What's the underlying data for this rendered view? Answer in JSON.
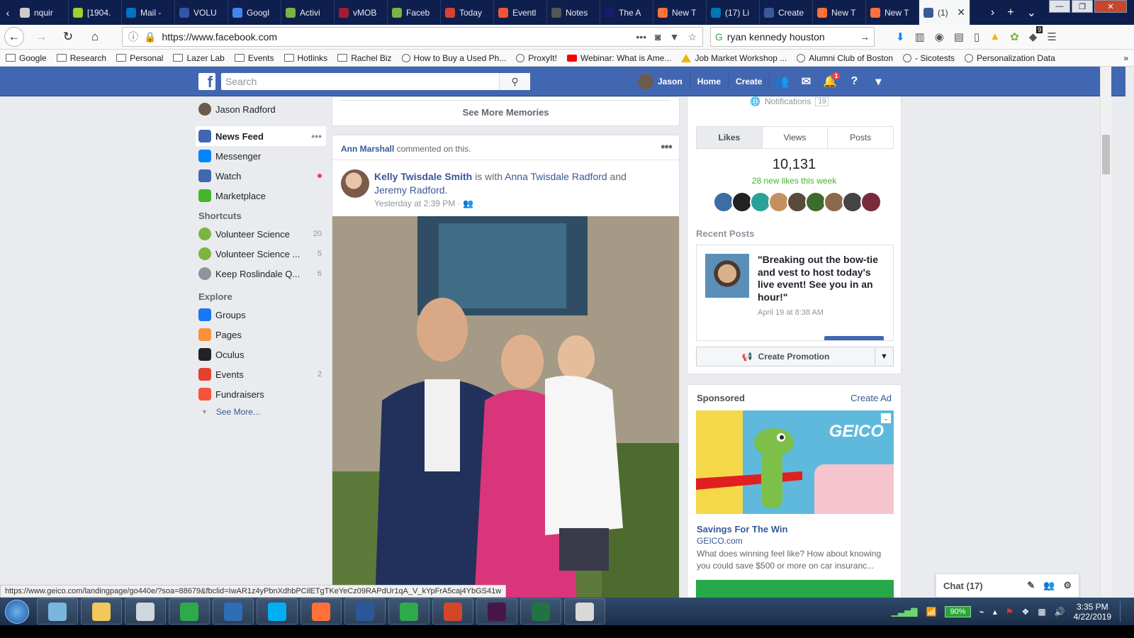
{
  "browser": {
    "tabs": [
      {
        "label": "nquir",
        "color": "#cccccc"
      },
      {
        "label": "[1904.",
        "color": "#9ad22e"
      },
      {
        "label": "Mail -",
        "color": "#0072c6"
      },
      {
        "label": "VOLU",
        "color": "#3355aa"
      },
      {
        "label": "Googl",
        "color": "#4285f4"
      },
      {
        "label": "Activi",
        "color": "#7cb342"
      },
      {
        "label": "vMOB",
        "color": "#a51c30"
      },
      {
        "label": "Faceb",
        "color": "#7cb342"
      },
      {
        "label": "Today",
        "color": "#db4035"
      },
      {
        "label": "Eventl",
        "color": "#f05537"
      },
      {
        "label": "Notes",
        "color": "#555555"
      },
      {
        "label": "The A",
        "color": "#1a1a6e"
      },
      {
        "label": "New T",
        "color": "#ff7139"
      },
      {
        "label": "(17) Li",
        "color": "#0077b5"
      },
      {
        "label": "Create",
        "color": "#3b5998"
      },
      {
        "label": "New T",
        "color": "#ff7139"
      },
      {
        "label": "New T",
        "color": "#ff7139"
      }
    ],
    "active_tab": {
      "label": "(1)",
      "color": "#3b5998"
    },
    "url": "https://www.facebook.com",
    "search_query": "ryan kennedy houston",
    "addon_badge": "9",
    "bookmarks": [
      {
        "label": "Google",
        "icon": "folder-icon"
      },
      {
        "label": "Research",
        "icon": "folder-icon"
      },
      {
        "label": "Personal",
        "icon": "folder-icon"
      },
      {
        "label": "Lazer Lab",
        "icon": "folder-icon"
      },
      {
        "label": "Events",
        "icon": "folder-icon"
      },
      {
        "label": "Hotlinks",
        "icon": "folder-icon"
      },
      {
        "label": "Rachel Biz",
        "icon": "folder-icon"
      },
      {
        "label": "How to Buy a Used Ph...",
        "icon": "site-icon"
      },
      {
        "label": "ProxyIt!",
        "icon": "site-icon"
      },
      {
        "label": "Webinar: What is Ame...",
        "icon": "youtube-icon"
      },
      {
        "label": "Job Market Workshop ...",
        "icon": "drive-icon"
      },
      {
        "label": "Alumni Club of Boston",
        "icon": "site-icon"
      },
      {
        "label": "- Sicotests",
        "icon": "site-icon"
      },
      {
        "label": "Personalization Data",
        "icon": "site-icon"
      }
    ],
    "status_url": "https://www.geico.com/landingpage/go440e/?soa=88679&fbclid=IwAR1z4yPbnXdhbPCilETgTKeYeCz09RAPdUr1qA_V_kYpFrA5caj4YbGS41w"
  },
  "facebook": {
    "search_placeholder": "Search",
    "user_short": "Jason",
    "nav": {
      "home": "Home",
      "create": "Create",
      "notif_badge": "1"
    },
    "left": {
      "profile_name": "Jason Radford",
      "main_items": [
        {
          "label": "News Feed",
          "icon": "news-feed-icon",
          "color": "#4267b2"
        },
        {
          "label": "Messenger",
          "icon": "messenger-icon",
          "color": "#0084ff"
        },
        {
          "label": "Watch",
          "icon": "watch-icon",
          "color": "#4267b2"
        },
        {
          "label": "Marketplace",
          "icon": "marketplace-icon",
          "color": "#42b72a"
        }
      ],
      "shortcuts_heading": "Shortcuts",
      "shortcuts": [
        {
          "label": "Volunteer Science",
          "count": "20",
          "color": "#7cb342"
        },
        {
          "label": "Volunteer Science ...",
          "count": "5",
          "color": "#7cb342"
        },
        {
          "label": "Keep Roslindale Q...",
          "count": "6",
          "color": "#8d949e"
        }
      ],
      "explore_heading": "Explore",
      "explore": [
        {
          "label": "Groups",
          "count": "",
          "icon": "groups-icon",
          "color": "#1877f2"
        },
        {
          "label": "Pages",
          "count": "",
          "icon": "pages-icon",
          "color": "#f7923b"
        },
        {
          "label": "Oculus",
          "count": "",
          "icon": "oculus-icon",
          "color": "#222222"
        },
        {
          "label": "Events",
          "count": "2",
          "icon": "events-icon",
          "color": "#e3412f"
        },
        {
          "label": "Fundraisers",
          "count": "",
          "icon": "fundraisers-icon",
          "color": "#f5533d"
        }
      ],
      "see_more": "See More..."
    },
    "memories": {
      "see_more": "See More Memories"
    },
    "post": {
      "activity_actor": "Ann Marshall",
      "activity_text": "commented on this.",
      "author": "Kelly Twisdale Smith",
      "with_text": "is with",
      "tag1": "Anna Twisdale Radford",
      "and_text": "and",
      "tag2": "Jeremy Radford.",
      "time": "Yesterday at 2:39 PM"
    },
    "right": {
      "notifications_label": "Notifications",
      "notifications_count": "19",
      "tabs": [
        "Likes",
        "Views",
        "Posts"
      ],
      "likes_total": "10,131",
      "likes_new": "28 new likes this week",
      "recent_heading": "Recent Posts",
      "recent_post_text": "\"Breaking out the bow-tie and vest to host today's live event! See you in an hour!\"",
      "recent_post_date": "April 19 at 8:38 AM",
      "promo_label": "Create Promotion",
      "sponsored_heading": "Sponsored",
      "create_ad": "Create Ad",
      "ad_logo": "GEICO",
      "ad_title": "Savings For The Win",
      "ad_domain": "GEICO.com",
      "ad_desc": "What does winning feel like? How about knowing you could save $500 or more on car insuranc..."
    },
    "chat_label": "Chat (17)"
  },
  "taskbar": {
    "battery": "90%",
    "time": "3:35 PM",
    "date": "4/22/2019",
    "apps": [
      {
        "name": "files-app",
        "color": "#7ab7e0"
      },
      {
        "name": "explorer-app",
        "color": "#f2c75c"
      },
      {
        "name": "shield-app",
        "color": "#cfd6de"
      },
      {
        "name": "loop-app",
        "color": "#2faa4a"
      },
      {
        "name": "r-app",
        "color": "#2f6db5"
      },
      {
        "name": "skype-app",
        "color": "#00aff0"
      },
      {
        "name": "firefox-app",
        "color": "#ff7139"
      },
      {
        "name": "word-app",
        "color": "#2b579a"
      },
      {
        "name": "loop2-app",
        "color": "#2faa4a"
      },
      {
        "name": "powerpoint-app",
        "color": "#d24726"
      },
      {
        "name": "slack-app",
        "color": "#4a154b"
      },
      {
        "name": "excel-app",
        "color": "#217346"
      },
      {
        "name": "paint-app",
        "color": "#d9d9d9"
      }
    ]
  }
}
